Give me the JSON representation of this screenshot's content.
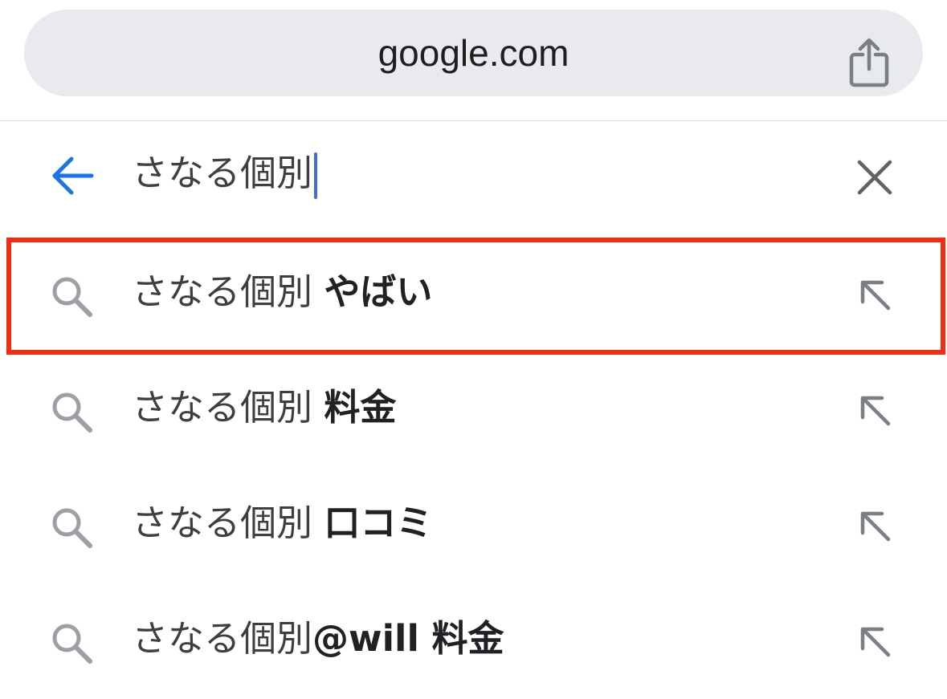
{
  "url_bar": {
    "url": "google.com",
    "share_icon": "share-icon"
  },
  "search": {
    "back_icon": "arrow-left-icon",
    "query": "さなる個別",
    "clear_icon": "close-icon"
  },
  "suggestions": [
    {
      "prefix": "さなる個別 ",
      "bold": "やばい"
    },
    {
      "prefix": "さなる個別 ",
      "bold": "料金"
    },
    {
      "prefix": "さなる個別 ",
      "bold": "口コミ"
    },
    {
      "prefix": "さなる個別",
      "bold": "@will 料金"
    }
  ],
  "colors": {
    "url_bar_bg": "#e8eaed",
    "back_arrow": "#1a73e8",
    "caret": "#4169e1",
    "highlight_border": "#f22b12",
    "icon_gray": "#9aa0a6"
  }
}
